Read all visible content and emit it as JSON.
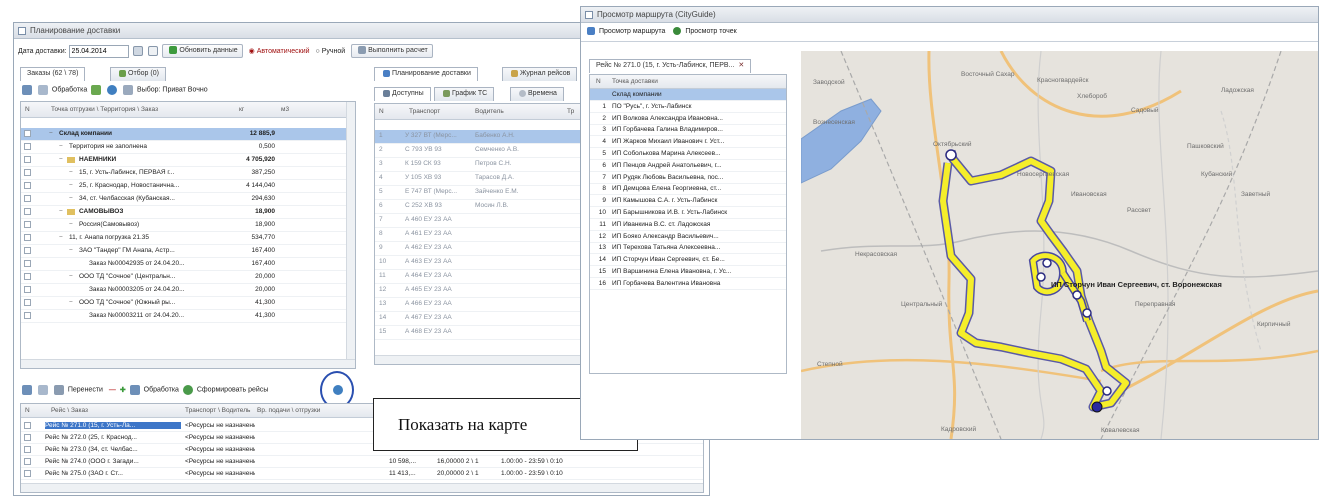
{
  "left_window": {
    "title": "Планирование доставки",
    "toolbar": {
      "date_label": "Дата доставки:",
      "date_value": "25.04.2014",
      "refresh_label": "Обновить данные",
      "mode_auto_label": "Автоматический",
      "mode_manual_label": "Ручной",
      "calculate_label": "Выполнить расчет"
    },
    "tabs_left": [
      "Заказы (62 \\ 78)",
      "Отбор (0)"
    ],
    "tabs_right": [
      "Планирование доставки",
      "Журнал рейсов"
    ],
    "orders_toolbar": {
      "process_label": "Обработка",
      "view_label": "Выбор: Приват Вочно"
    },
    "orders_grid": {
      "headers": [
        "N",
        "Точка отгрузки \\ Территория \\ Заказ",
        "кг",
        "м3"
      ],
      "rows": [
        {
          "text": "Склад компании",
          "value": "12 885,9",
          "level": 0,
          "bold": true,
          "selected": true
        },
        {
          "text": "Территория не заполнена",
          "value": "0,500",
          "level": 1
        },
        {
          "text": "НАЕМНИКИ",
          "value": "4 705,920",
          "level": 1,
          "bold": true,
          "folder": true
        },
        {
          "text": "15, г. Усть-Лабинск, ПЕРВАЯ г...",
          "value": "387,250",
          "level": 2
        },
        {
          "text": "25, г. Краснодар, Новостанична...",
          "value": "4 144,040",
          "level": 2
        },
        {
          "text": "34, ст. Челбасская (Кубанская...",
          "value": "294,630",
          "level": 2
        },
        {
          "text": "САМОВЫВОЗ",
          "value": "18,900",
          "level": 1,
          "bold": true,
          "folder": true
        },
        {
          "text": "Россия(Самовывоз)",
          "value": "18,900",
          "level": 2
        },
        {
          "text": "11, г. Анапа погрузка 21.35",
          "value": "534,770",
          "level": 1
        },
        {
          "text": "ЗАО \"Тандер\" ГМ Анапа, Астр...",
          "value": "167,400",
          "level": 2
        },
        {
          "text": "Заказ №00042935 от 24.04.20...",
          "value": "167,400",
          "level": 3
        },
        {
          "text": "ООО ТД \"Сочное\" (Центральн...",
          "value": "20,000",
          "level": 2
        },
        {
          "text": "Заказ №00003205 от 24.04.20...",
          "value": "20,000",
          "level": 3
        },
        {
          "text": "ООО ТД \"Сочное\" (Южный ры...",
          "value": "41,300",
          "level": 2
        },
        {
          "text": "Заказ №00003211 от 24.04.20...",
          "value": "41,300",
          "level": 3
        }
      ]
    },
    "planning_tabs": [
      "Доступны",
      "График ТС",
      "Времена"
    ],
    "planning_grid": {
      "headers": [
        "N",
        "Транспорт",
        "Водитель",
        "Тр"
      ],
      "rows": [
        {
          "n": "1",
          "transport": "У 327 ВТ (Мерс...",
          "driver": "Бабенко А.Н.",
          "sel": true
        },
        {
          "n": "2",
          "transport": "С 793 УВ 93",
          "driver": "Семченко А.В."
        },
        {
          "n": "3",
          "transport": "К 159 СК 93",
          "driver": "Петров С.Н."
        },
        {
          "n": "4",
          "transport": "У 105 ХВ 93",
          "driver": "Тарасов Д.А."
        },
        {
          "n": "5",
          "transport": "Е 747 ВТ (Мерс...",
          "driver": "Зайченко Е.М."
        },
        {
          "n": "6",
          "transport": "С 252 ХВ 93",
          "driver": "Мосин Л.В."
        },
        {
          "n": "7",
          "transport": "А 460 ЕУ 23 АА",
          "driver": ""
        },
        {
          "n": "8",
          "transport": "А 461 ЕУ 23 АА",
          "driver": ""
        },
        {
          "n": "9",
          "transport": "А 462 ЕУ 23 АА",
          "driver": ""
        },
        {
          "n": "10",
          "transport": "А 463 ЕУ 23 АА",
          "driver": ""
        },
        {
          "n": "11",
          "transport": "А 464 ЕУ 23 АА",
          "driver": ""
        },
        {
          "n": "12",
          "transport": "А 465 ЕУ 23 АА",
          "driver": ""
        },
        {
          "n": "13",
          "transport": "А 466 ЕУ 23 АА",
          "driver": ""
        },
        {
          "n": "14",
          "transport": "А 467 ЕУ 23 АА",
          "driver": ""
        },
        {
          "n": "15",
          "transport": "А 468 ЕУ 23 АА",
          "driver": ""
        }
      ]
    },
    "routes_toolbar": {
      "transport_label": "Перенести",
      "process_label": "Обработка",
      "form_label": "Сформировать рейсы"
    },
    "routes_grid": {
      "headers": [
        "N",
        "Рейс \\ Заказ",
        "Транспорт \\ Водитель",
        "Вр. подачи \\ отгрузки"
      ],
      "rows": [
        {
          "route": "Рейс № 271.0 (15, г. Усть-Ла...",
          "driver": "<Ресурсы не назначены>",
          "sel": true
        },
        {
          "route": "Рейс № 272.0 (25, г. Краснод...",
          "driver": "<Ресурсы не назначены>"
        },
        {
          "route": "Рейс № 273.0 (34, ст. Челбас...",
          "driver": "<Ресурсы не назначены>"
        },
        {
          "route": "Рейс № 274.0 (ООО г. Загади...",
          "driver": "<Ресурсы не назначены>",
          "weight": "10 598,...",
          "time": "16,00000  2 \\ 1",
          "period": "1.00:00 - 23:59 \\ 0:10"
        },
        {
          "route": "Рейс № 275.0 (ЗАО г. Ст...",
          "driver": "<Ресурсы не назначены>",
          "weight": "11 413,...",
          "time": "20,00000  2 \\ 1",
          "period": "1.00:00 - 23:59 \\ 0:10"
        }
      ]
    }
  },
  "tooltip": {
    "text": "Показать на карте"
  },
  "route_window": {
    "title": "Просмотр маршрута (CityGuide)",
    "toolbar": {
      "route_view_label": "Просмотр маршрута",
      "points_view_label": "Просмотр точек"
    },
    "route_tab": "Рейс № 271.0 (15, г. Усть-Лабинск, ПЕРВ...",
    "list_headers": [
      "N",
      "Точка доставки"
    ],
    "points": [
      {
        "n": "",
        "name": "Склад компании"
      },
      {
        "n": "1",
        "name": "ПО \"Русь\", г. Усть-Лабинск"
      },
      {
        "n": "2",
        "name": "ИП Волкова Александра Ивановна..."
      },
      {
        "n": "3",
        "name": "ИП Горбачева Галина Владимиров..."
      },
      {
        "n": "4",
        "name": "ИП Жарков Михаил Иванович г. Уст..."
      },
      {
        "n": "5",
        "name": "ИП Соболькова Марина Алексеев..."
      },
      {
        "n": "6",
        "name": "ИП Пенцов Андрей Анатольевич, г..."
      },
      {
        "n": "7",
        "name": "ИП Рудяк Любовь Васильевна, пос..."
      },
      {
        "n": "8",
        "name": "ИП Демцова Елена Георгиевна, ст..."
      },
      {
        "n": "9",
        "name": "ИП Камышова С.А. г. Усть-Лабинск"
      },
      {
        "n": "10",
        "name": "ИП Барышникова И.В. г. Усть-Лабинск"
      },
      {
        "n": "11",
        "name": "ИП Иванкина В.С. ст. Ладожская"
      },
      {
        "n": "12",
        "name": "ИП Бояко Александр Васильевич..."
      },
      {
        "n": "13",
        "name": "ИП Терехова Татьяна Алексеевна..."
      },
      {
        "n": "14",
        "name": "ИП Сторчун Иван Сергеевич, ст. Бе..."
      },
      {
        "n": "15",
        "name": "ИП Варшинина Елена Ивановна, г. Ус..."
      },
      {
        "n": "16",
        "name": "ИП Горбачева Валентина Ивановна"
      }
    ],
    "map_labels": [
      {
        "text": "Заводской"
      },
      {
        "text": "Восточный Сахар"
      },
      {
        "text": "Красногвардейск"
      },
      {
        "text": "Хлебороб"
      },
      {
        "text": "Садовый"
      },
      {
        "text": "Ладожская"
      },
      {
        "text": "Вознесенская"
      },
      {
        "text": "Пашковский"
      },
      {
        "text": "Октябрьский"
      },
      {
        "text": "Новосергиевская"
      },
      {
        "text": "Кубанский"
      },
      {
        "text": "Заветный"
      },
      {
        "text": "Ивановская"
      },
      {
        "text": "Рассвет"
      },
      {
        "text": "Центральный"
      },
      {
        "text": "Некрасовская"
      },
      {
        "text": "Переправная"
      },
      {
        "text": "Кирпичный"
      },
      {
        "text": "Степной"
      },
      {
        "text": "Ковалевская"
      },
      {
        "text": "Кадровский"
      }
    ],
    "map_marker_text": "ИП Сторчун Иван Сергеевич, ст. Воронежская"
  }
}
